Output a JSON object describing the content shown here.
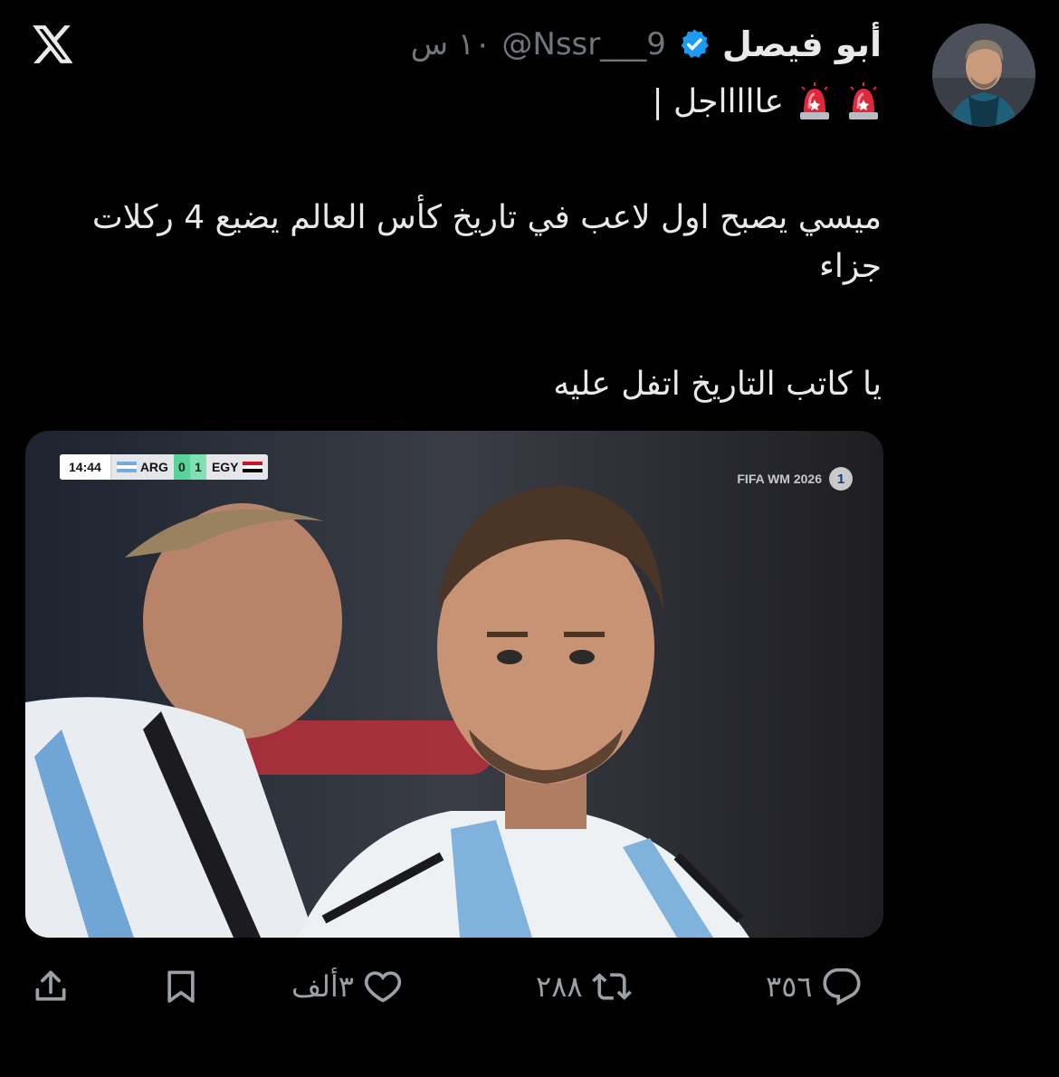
{
  "tweet": {
    "display_name": "أبو فيصل",
    "handle": "@Nssr___9",
    "time": "١٠ س",
    "line1": "عاااااجل |",
    "paragraph1": "ميسي يصبح اول لاعب في تاريخ كأس العالم يضيع 4 ركلات جزاء",
    "paragraph2": "يا كاتب التاريخ اتفل عليه"
  },
  "media": {
    "scorebug": {
      "clock": "14:44",
      "team_home": "ARG",
      "score_home": "0",
      "score_away": "1",
      "team_away": "EGY"
    },
    "watermark": "FIFA WM 2026",
    "channel_logo": "1"
  },
  "actions": {
    "replies": "٣٥٦",
    "reposts": "٢٨٨",
    "likes": "٣ألف"
  },
  "icons": {
    "logo": "x-logo-icon",
    "verified": "verified-badge-icon",
    "siren": "police-light-emoji",
    "reply": "reply-icon",
    "repost": "repost-icon",
    "like": "heart-icon",
    "bookmark": "bookmark-icon",
    "share": "share-icon"
  },
  "colors": {
    "background": "#000000",
    "text": "#e7e9ea",
    "muted": "#71767b",
    "verified": "#1d9bf0"
  }
}
